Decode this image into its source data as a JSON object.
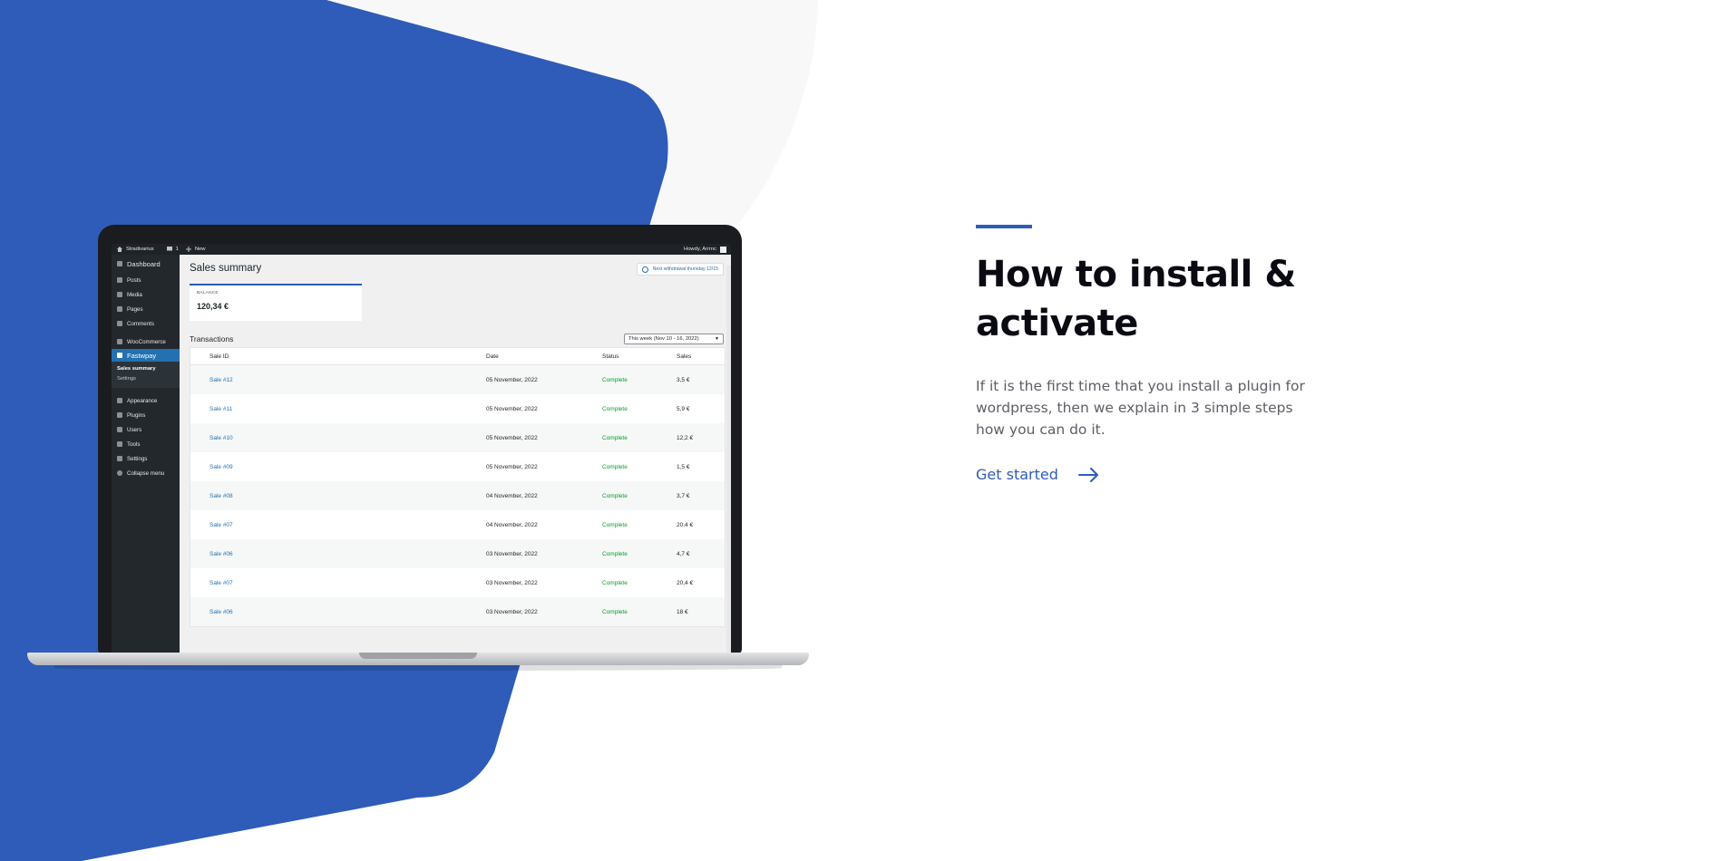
{
  "hero": {
    "title_line1": "How to install &",
    "title_line2": "activate",
    "description": "If it is the first time that you install a plugin for wordpress, then we explain in 3 simple steps how you can do it.",
    "cta_label": "Get started",
    "cta_icon": "arrow-right-icon"
  },
  "colors": {
    "brand_blue": "#2e5cb8",
    "wp_admin_dark": "#23282d",
    "wp_active": "#2271b1",
    "status_green": "#00a32a"
  },
  "admin_bar": {
    "site_name": "Stradivarius",
    "comments_count": "1",
    "new_label": "New",
    "greeting": "Howdy, Arrrnc"
  },
  "sidebar": {
    "items": [
      {
        "label": "Dashboard",
        "icon": "dashboard-icon"
      },
      {
        "label": "Posts",
        "icon": "pin-icon"
      },
      {
        "label": "Media",
        "icon": "media-icon"
      },
      {
        "label": "Pages",
        "icon": "page-icon"
      },
      {
        "label": "Comments",
        "icon": "comment-icon"
      },
      {
        "label": "WooCommerce",
        "icon": "woo-icon"
      },
      {
        "label": "Fastwpay",
        "icon": "fastwpay-icon"
      },
      {
        "label": "Appearance",
        "icon": "brush-icon"
      },
      {
        "label": "Plugins",
        "icon": "plug-icon"
      },
      {
        "label": "Users",
        "icon": "user-icon"
      },
      {
        "label": "Tools",
        "icon": "wrench-icon"
      },
      {
        "label": "Settings",
        "icon": "settings-icon"
      },
      {
        "label": "Collapse menu",
        "icon": "collapse-icon"
      }
    ],
    "submenu": [
      "Sales summary",
      "Settings"
    ]
  },
  "main": {
    "page_title": "Sales summary",
    "notice": "Next withdrawal thursday 12/15",
    "balance_label": "BALANCE",
    "balance_value": "120,34 €",
    "section_title": "Transactions",
    "date_filter": "This week (Nov 10 - 16, 2022)",
    "columns": [
      "Sale ID",
      "Date",
      "Status",
      "Sales"
    ],
    "rows": [
      {
        "id": "Sale #12",
        "date": "05 November, 2022",
        "status": "Complete",
        "amount": "3,5 €"
      },
      {
        "id": "Sale #11",
        "date": "05 November, 2022",
        "status": "Complete",
        "amount": "5,9 €"
      },
      {
        "id": "Sale #10",
        "date": "05 November, 2022",
        "status": "Complete",
        "amount": "12,2 €"
      },
      {
        "id": "Sale #09",
        "date": "05 November, 2022",
        "status": "Complete",
        "amount": "1,5 €"
      },
      {
        "id": "Sale #08",
        "date": "04 November, 2022",
        "status": "Complete",
        "amount": "3,7 €"
      },
      {
        "id": "Sale #07",
        "date": "04 November, 2022",
        "status": "Complete",
        "amount": "20,4 €"
      },
      {
        "id": "Sale #06",
        "date": "03 November, 2022",
        "status": "Complete",
        "amount": "4,7 €"
      },
      {
        "id": "Sale #07",
        "date": "03 November, 2022",
        "status": "Complete",
        "amount": "20,4 €"
      },
      {
        "id": "Sale #06",
        "date": "03 November, 2022",
        "status": "Complete",
        "amount": "18 €"
      }
    ]
  }
}
